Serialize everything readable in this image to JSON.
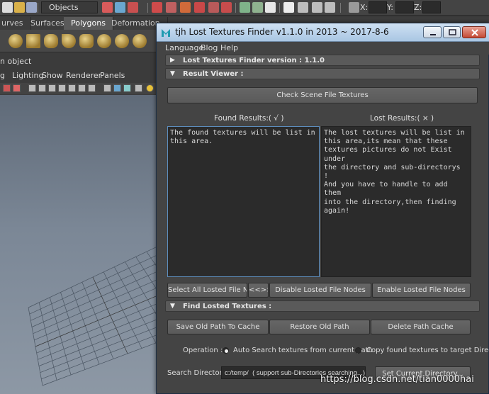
{
  "maya": {
    "mode_selector": "Objects",
    "coords": [
      "X:",
      "Y:",
      "Z:"
    ],
    "shelf_tabs": [
      "urves",
      "Surfaces",
      "Polygons",
      "Deformation"
    ],
    "active_shelf_tab": "Polygons",
    "object_line": "n object",
    "panel_menu": [
      "g",
      "Lighting",
      "Show",
      "Renderer",
      "Panels"
    ]
  },
  "window": {
    "title": "tjh Lost Textures Finder v1.1.0  in 2013 ~ 2017-8-6",
    "menu": [
      "Language",
      "Blog",
      "Help"
    ]
  },
  "sections": {
    "version": {
      "label": "Lost  Textures  Finder  version  :  1.1.0",
      "arrow": "▶"
    },
    "result_viewer": {
      "label": "Result  Viewer  :",
      "arrow": "▼"
    },
    "find_losted": {
      "label": "Find  Losted  Textures  :",
      "arrow": "▼"
    }
  },
  "result_viewer": {
    "check_button": "Check Scene File Textures",
    "found_title": "Found  Results:( √ )",
    "lost_title": "Lost  Results:( × )",
    "found_text": "The found textures will be list in\nthis area.",
    "lost_text": "The lost textures will be list in\nthis area,its mean that these\ntextures pictures do not Exist under\nthe directory and sub-directorys !\nAnd you have to handle to add them\ninto the directory,then finding\nagain!",
    "select_all_button": "Select All Losted File Nodes",
    "swap_button": "<<>>",
    "disable_button": "Disable Losted File Nodes",
    "enable_button": "Enable Losted File Nodes"
  },
  "find": {
    "save_cache_button": "Save Old Path To Cache",
    "restore_button": "Restore Old Path",
    "delete_cache_button": "Delete Path Cache",
    "operation_label": "Operation :",
    "option_auto": "Auto Search textures from current path",
    "option_copy": "Copy found textures to target Directo",
    "selected_option": "auto",
    "search_dir_label": "Search Directory:",
    "search_dir_value": "c:/temp/  ( support sub-Directories searching...)",
    "set_current_button": "Set Current Directory..."
  },
  "watermark": "https://blog.csdn.net/tian0000hai",
  "colors": {
    "title_bar": "#b9d2ea",
    "close_button": "#c44a35",
    "panel_bg": "#444444",
    "text_area_bg": "#2b2b2b",
    "focus_border": "#5d8dbd"
  }
}
